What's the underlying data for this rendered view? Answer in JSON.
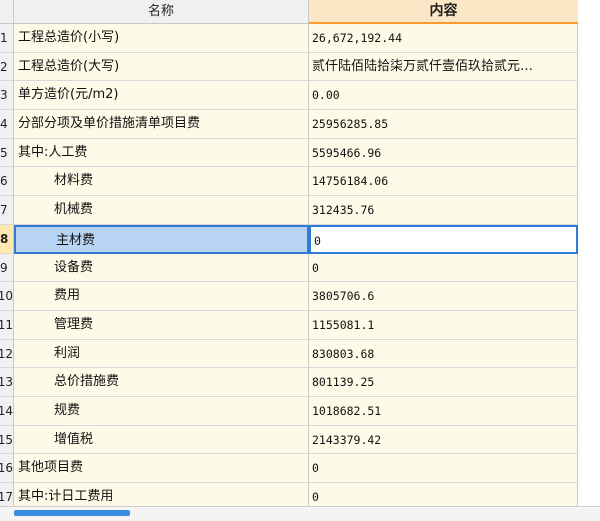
{
  "header": {
    "name_col": "名称",
    "content_col": "内容"
  },
  "rows": [
    {
      "index": "1",
      "name": "工程总造价(小写)",
      "value": "26,672,192.44",
      "indent": false
    },
    {
      "index": "2",
      "name": "工程总造价(大写)",
      "value": "贰仟陆佰陆拾柒万贰仟壹佰玖拾贰元…",
      "indent": false,
      "cjk": true
    },
    {
      "index": "3",
      "name": "单方造价(元/m2)",
      "value": "0.00",
      "indent": false
    },
    {
      "index": "4",
      "name": "分部分项及单价措施清单项目费",
      "value": "25956285.85",
      "indent": false
    },
    {
      "index": "5",
      "name": "其中:人工费",
      "value": "5595466.96",
      "indent": false
    },
    {
      "index": "6",
      "name": "材料费",
      "value": "14756184.06",
      "indent": true
    },
    {
      "index": "7",
      "name": "机械费",
      "value": "312435.76",
      "indent": true
    },
    {
      "index": "8",
      "name": "主材费",
      "value": "0",
      "indent": true,
      "selected": true
    },
    {
      "index": "9",
      "name": "设备费",
      "value": "0",
      "indent": true
    },
    {
      "index": "10",
      "name": "费用",
      "value": "3805706.6",
      "indent": true
    },
    {
      "index": "11",
      "name": "管理费",
      "value": "1155081.1",
      "indent": true
    },
    {
      "index": "12",
      "name": "利润",
      "value": "830803.68",
      "indent": true
    },
    {
      "index": "13",
      "name": "总价措施费",
      "value": "801139.25",
      "indent": true
    },
    {
      "index": "14",
      "name": "规费",
      "value": "1018682.51",
      "indent": true
    },
    {
      "index": "15",
      "name": "增值税",
      "value": "2143379.42",
      "indent": true
    },
    {
      "index": "16",
      "name": "其他项目费",
      "value": "0",
      "indent": false
    },
    {
      "index": "17",
      "name": "其中:计日工费用",
      "value": "0",
      "indent": false
    }
  ]
}
